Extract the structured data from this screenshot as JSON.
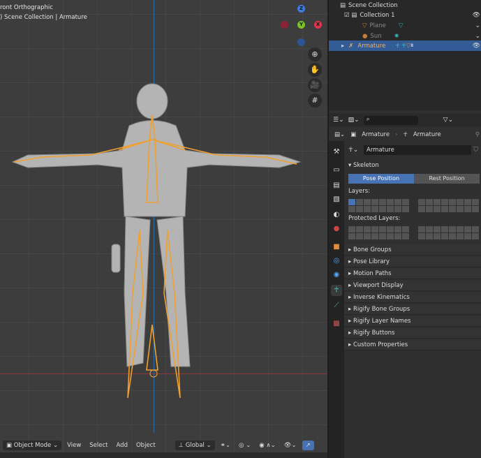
{
  "viewport": {
    "view_name": "ront Orthographic",
    "context": ") Scene Collection | Armature",
    "gizmo": {
      "z": "Z",
      "y": "Y",
      "x": "X"
    },
    "header": {
      "mode": "Object Mode",
      "menus": [
        "View",
        "Select",
        "Add",
        "Object"
      ],
      "orientation": "Global"
    }
  },
  "outliner": {
    "root": "Scene Collection",
    "items": [
      {
        "label": "Collection 1"
      },
      {
        "label": "Plane"
      },
      {
        "label": "Sun"
      },
      {
        "label": "Armature",
        "badge": "8"
      }
    ]
  },
  "properties": {
    "breadcrumb": [
      "Armature",
      "Armature"
    ],
    "data_name": "Armature",
    "skeleton": {
      "title": "Skeleton",
      "pose": "Pose Position",
      "rest": "Rest Position",
      "layers": "Layers:",
      "protected": "Protected Layers:"
    },
    "panels": [
      "Bone Groups",
      "Pose Library",
      "Motion Paths",
      "Viewport Display",
      "Inverse Kinematics",
      "Rigify Bone Groups",
      "Rigify Layer Names",
      "Rigify Buttons",
      "Custom Properties"
    ]
  },
  "colors": {
    "accent": "#4772b3",
    "bone": "#f0a030",
    "selected_row": "#335c96"
  }
}
